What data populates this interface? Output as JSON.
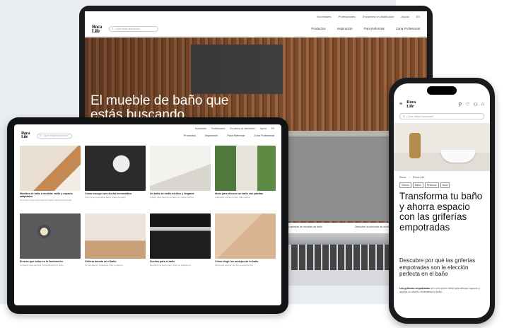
{
  "brand": {
    "logo_line1": "Roca",
    "logo_line2": "Life"
  },
  "laptop": {
    "utility_links": [
      "Novedades",
      "Profesionales",
      "Encuentra un distribuidor",
      "Ayuda",
      "ES"
    ],
    "search_placeholder": "¿Qué estás buscando?",
    "nav": [
      "Productos",
      "Inspiración",
      "Para Reformar",
      "Zona Profesional"
    ],
    "hero_title": "El mueble de baño que estás buscando",
    "info_1": "Conoce nuestra variedad de muebles de baño",
    "info_2": "Descubre la colección de muebles de baño"
  },
  "tablet": {
    "utility_links": [
      "Novedades",
      "Profesionales",
      "Encuentra un distribuidor",
      "Ayuda",
      "ES"
    ],
    "search_placeholder": "¿Qué estás buscando?",
    "nav": [
      "Productos",
      "Inspiración",
      "Para Reformar",
      "Zona Profesional"
    ],
    "cards": [
      {
        "title": "Muebles de baño a medida: estilo y espacio adaptados",
        "desc": "Descubre cómo encontrar el mueble ideal para tu baño"
      },
      {
        "title": "Cómo escoger una ducha termostática",
        "desc": "Todo lo que necesitas saber antes de elegir"
      },
      {
        "title": "Un baño de estilo nórdico y elegante",
        "desc": "Claves para decorar tu baño con estilo nórdico"
      },
      {
        "title": "Ideas para decorar un baño con plantas",
        "desc": "Inspiración para un baño más natural"
      },
      {
        "title": "Errores que evitar en la iluminación",
        "desc": "Consejos para iluminar correctamente tu baño"
      },
      {
        "title": "Grifería dorada en el baño",
        "desc": "Tendencias en acabados para tu grifería"
      },
      {
        "title": "Duchas para el baño",
        "desc": "Descubre la ducha que mejor se adapta a ti"
      },
      {
        "title": "Cómo elegir los azulejos de tu baño",
        "desc": "Guía para acertar con los revestimientos"
      }
    ]
  },
  "phone": {
    "search_placeholder": "¿Qué estás buscando?",
    "breadcrumbs": [
      "Roca",
      "Roca Life"
    ],
    "tags": [
      "Grifería",
      "Baños",
      "Reformas",
      "Ideas"
    ],
    "title": "Transforma tu baño y ahorra espacio con las griferías empotradas",
    "subtitle": "Descubre por qué las griferías empotradas son la elección perfecta en el baño",
    "body_bold": "Las griferías empotradas",
    "body": "son una opción ideal para ahorrar espacio y aportar un diseño minimalista al baño."
  },
  "colors": {
    "brand_dark": "#111111",
    "wood": "#8b5a36"
  },
  "icons": [
    "search-icon",
    "user-icon",
    "cart-icon",
    "menu-icon"
  ]
}
